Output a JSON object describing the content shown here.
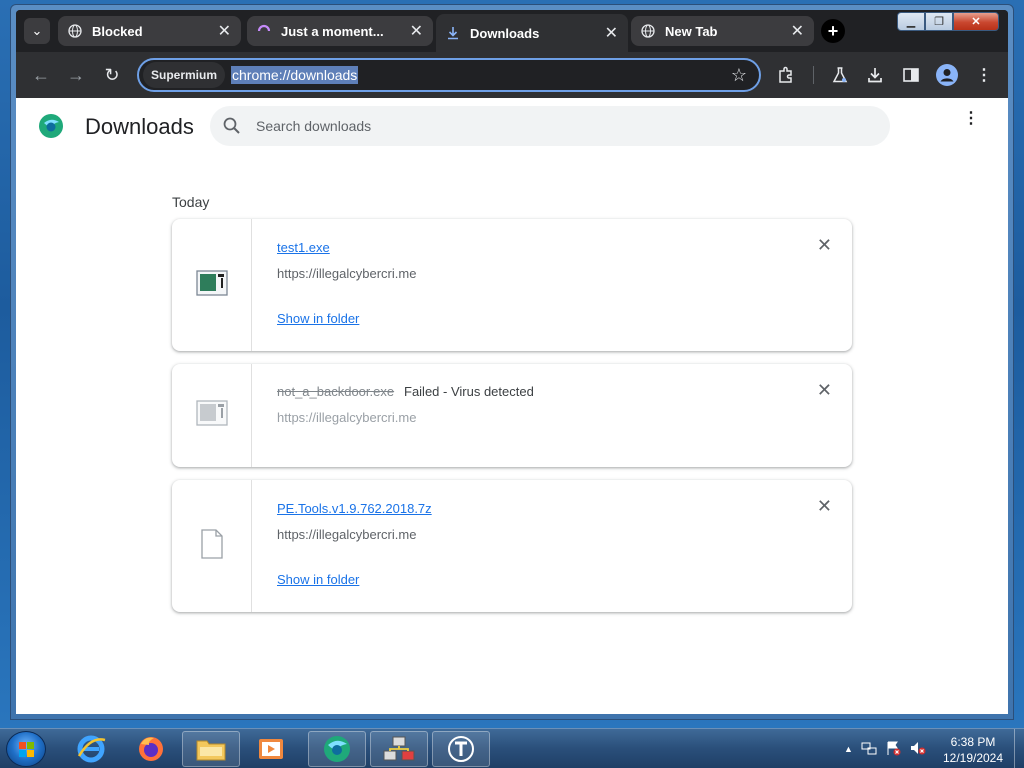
{
  "window": {
    "controls": {
      "minimize": "▁",
      "maximize": "❐",
      "close": "✕"
    }
  },
  "tabs": [
    {
      "title": "Blocked",
      "icon": "globe-icon",
      "close": "✕"
    },
    {
      "title": "Just a moment...",
      "icon": "loading-icon",
      "close": "✕"
    },
    {
      "title": "Downloads",
      "icon": "download-icon",
      "close": "✕",
      "active": true
    },
    {
      "title": "New Tab",
      "icon": "globe-icon",
      "close": "✕"
    }
  ],
  "tab_search": "⌄",
  "new_tab": "+",
  "toolbar": {
    "back": "←",
    "forward": "→",
    "reload": "↻",
    "site_chip": "Supermium",
    "url": "chrome://downloads",
    "star": "☆"
  },
  "page": {
    "title": "Downloads",
    "search_placeholder": "Search downloads",
    "more": "⋮",
    "day_label": "Today",
    "downloads": [
      {
        "filename": "test1.exe",
        "source": "https://illegalcybercri.me",
        "action": "Show in folder",
        "status": "",
        "failed": false
      },
      {
        "filename": "not_a_backdoor.exe",
        "source": "https://illegalcybercri.me",
        "action": "",
        "status": "Failed - Virus detected",
        "failed": true
      },
      {
        "filename": "PE.Tools.v1.9.762.2018.7z",
        "source": "https://illegalcybercri.me",
        "action": "Show in folder",
        "status": "",
        "failed": false
      }
    ],
    "remove": "✕"
  },
  "taskbar": {
    "pinned": [
      "internet-explorer-icon",
      "firefox-icon",
      "file-explorer-icon",
      "media-player-icon",
      "supermium-icon",
      "network-app-icon",
      "tor-icon"
    ],
    "clock_time": "6:38 PM",
    "clock_date": "12/19/2024",
    "tray_arrow": "▲"
  },
  "colors": {
    "accent": "#1a73e8",
    "browser_dark": "#202124",
    "toolbar": "#2f3033",
    "omnibox_border": "#6e9fe6"
  }
}
